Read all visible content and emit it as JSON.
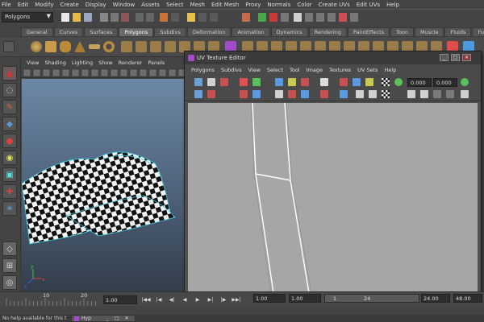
{
  "menubar": [
    "File",
    "Edit",
    "Modify",
    "Create",
    "Display",
    "Window",
    "Assets",
    "Select",
    "Mesh",
    "Edit Mesh",
    "Proxy",
    "Normals",
    "Color",
    "Create UVs",
    "Edit UVs",
    "Help"
  ],
  "status": {
    "mode": "Polygons"
  },
  "shelf_tabs": [
    {
      "label": "General",
      "active": false
    },
    {
      "label": "Curves",
      "active": false
    },
    {
      "label": "Surfaces",
      "active": false
    },
    {
      "label": "Polygons",
      "active": true
    },
    {
      "label": "Subdivs",
      "active": false
    },
    {
      "label": "Deformation",
      "active": false
    },
    {
      "label": "Animation",
      "active": false
    },
    {
      "label": "Dynamics",
      "active": false
    },
    {
      "label": "Rendering",
      "active": false
    },
    {
      "label": "PaintEffects",
      "active": false
    },
    {
      "label": "Toon",
      "active": false
    },
    {
      "label": "Muscle",
      "active": false
    },
    {
      "label": "Fluids",
      "active": false
    },
    {
      "label": "Fur",
      "active": false
    }
  ],
  "viewport": {
    "menu": [
      "View",
      "Shading",
      "Lighting",
      "Show",
      "Renderer",
      "Panels"
    ],
    "axis_labels": [
      "y",
      "x",
      "z"
    ]
  },
  "uv_editor": {
    "title": "UV Texture Editor",
    "menu": [
      "Polygons",
      "Subdivs",
      "View",
      "Select",
      "Tool",
      "Image",
      "Textures",
      "UV Sets",
      "Help"
    ],
    "u_value": "0.000",
    "v_value": "0.000",
    "window_buttons": [
      "_",
      "□",
      "✕"
    ]
  },
  "timeslider": {
    "ticks": [
      "10",
      "20"
    ],
    "current": "1.00"
  },
  "range": {
    "start": "1.00",
    "playback_start": "1.00",
    "frame": "1",
    "end_marker": "24",
    "playback_end": "24.00",
    "end": "48.00"
  },
  "playback_buttons": [
    "|◀◀",
    "|◀",
    "◀|",
    "◀",
    "▶",
    "▶|",
    "|▶",
    "▶▶|"
  ],
  "help": {
    "text": "No help available for this t"
  },
  "minihyper": {
    "label": "Hyp",
    "buttons": [
      "_",
      "□",
      "✕"
    ]
  },
  "colors": {
    "uv_bg": "#a6a6a6",
    "uv_shell_line": "#ffffff",
    "viewport_top": "#6d88a6",
    "viewport_bottom": "#333d4a",
    "wireframe": "#39d4e6"
  }
}
